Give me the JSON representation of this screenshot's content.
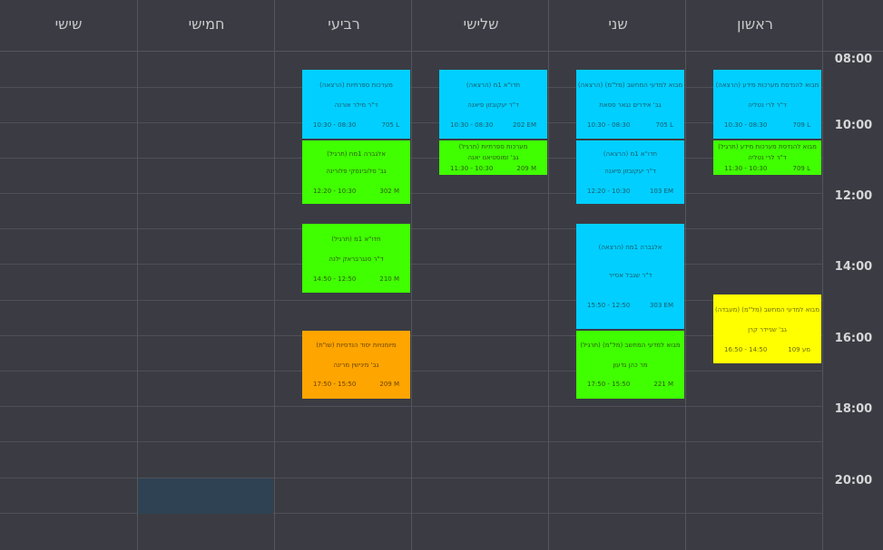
{
  "days": [
    "ראשון",
    "שני",
    "שלישי",
    "רביעי",
    "חמישי",
    "שישי"
  ],
  "times": [
    "08:00",
    "10:00",
    "12:00",
    "14:00",
    "16:00",
    "18:00",
    "20:00"
  ],
  "events": [
    {
      "title": "מבוא להנדסת מערכות מידע (הרצאה)",
      "lecturer": "ד\"ר לרי נטליה",
      "time": "10:30 - 08:30",
      "room": "709 L"
    },
    {
      "title": "מבוא להנדסת מערכות מידע (תרגיל)",
      "lecturer": "ד\"ר לרי נטליה",
      "time": "11:30 - 10:30",
      "room": "709 L"
    },
    {
      "title": "מבוא למדעי המחשב (מל\"מ) (מעבדה)",
      "lecturer": "גב' שניידר קרן",
      "time": "16:50 - 14:50",
      "room": "מע 109"
    },
    {
      "title": "מבוא למדעי המחשב (מל\"מ) (הרצאה)",
      "lecturer": "גב' אידרים נגאר ספאת",
      "time": "10:30 - 08:30",
      "room": "705 L"
    },
    {
      "title": "חדו\"א 1מ (הרצאה)",
      "lecturer": "ד\"ר יעקובזון פיאנה",
      "time": "12:20 - 10:30",
      "room": "103 EM"
    },
    {
      "title": "אלגברה 1מח (הרצאה)",
      "lecturer": "ד\"ר שגבל אסייר",
      "time": "15:50 - 12:50",
      "room": "303 EM"
    },
    {
      "title": "מבוא למדעי המחשב (מל\"מ) (תרגיל)",
      "lecturer": "מר כהן גדעון",
      "time": "17:50 - 15:50",
      "room": "221 M"
    },
    {
      "title": "חדו\"א 1מ (הרצאה)",
      "lecturer": "ד\"ר יעקובזון פיאנה",
      "time": "10:30 - 08:30",
      "room": "202 EM"
    },
    {
      "title": "מערכות ספרתיות (תרגיל)",
      "lecturer": "גב' זמוסטיאנו יאנה",
      "time": "11:30 - 10:30",
      "room": "209 M"
    },
    {
      "title": "מערכות ספרתיות (הרצאה)",
      "lecturer": "ד\"ר מילר אורנה",
      "time": "10:30 - 08:30",
      "room": "705 L"
    },
    {
      "title": "אלגברה 1מח (תרגיל)",
      "lecturer": "גב' סלובינסקי פלורינה",
      "time": "12:20 - 10:30",
      "room": "302 M"
    },
    {
      "title": "חדו\"א 1מ (תרגיל)",
      "lecturer": "ד\"ר סנגרבראק ילנה",
      "time": "14:50 - 12:50",
      "room": "210 M"
    },
    {
      "title": "מיומנויות יסוד הנדסיות (שו\"ת)",
      "lecturer": "גב' מינישין מרינה",
      "time": "17:50 - 15:50",
      "room": "209 M"
    }
  ],
  "colors": {
    "lecture": "#00cfff",
    "practice": "#40ff00",
    "lab": "#ffff00",
    "workshop": "#ffa500"
  }
}
